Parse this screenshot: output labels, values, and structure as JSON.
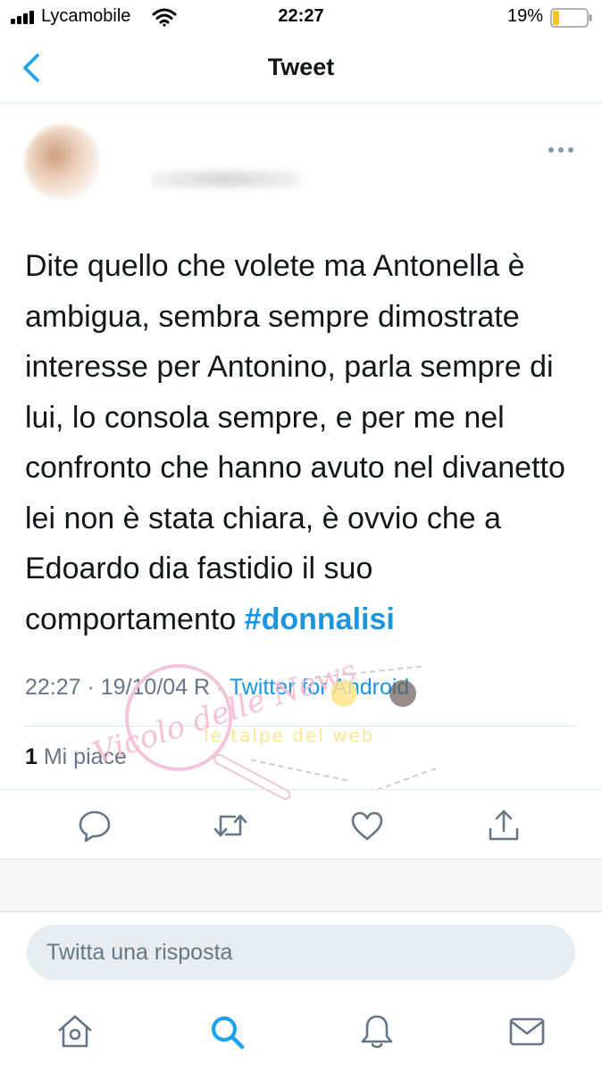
{
  "status_bar": {
    "carrier": "Lycamobile",
    "time": "22:27",
    "battery_percent": "19%",
    "battery_level": 0.19,
    "battery_color": "#f5c518"
  },
  "nav": {
    "title": "Tweet",
    "back_icon": "chevron-left-icon"
  },
  "tweet": {
    "text": "Dite quello che volete ma Antonella è ambigua, sembra sempre dimostrate interesse per Antonino, parla sempre di lui, lo consola sempre, e per me nel confronto che hanno avuto nel divanetto lei non è stata chiara, è ovvio che a Edoardo dia fastidio il suo comportamento ",
    "hashtag": "#donnalisi",
    "timestamp": "22:27 · 19/10/04 R · ",
    "source": "Twitter for Android",
    "likes_count": "1",
    "likes_label": " Mi piace"
  },
  "actions": [
    "reply-icon",
    "retweet-icon",
    "like-icon",
    "share-icon"
  ],
  "watermark": {
    "script_text": "Vicolo delle News",
    "banner_text": "le talpe del web"
  },
  "reply": {
    "placeholder": "Twitta una risposta"
  },
  "tabbar": [
    "home-icon",
    "search-icon",
    "notifications-icon",
    "messages-icon"
  ],
  "colors": {
    "accent": "#1da1f2",
    "hashtag": "#1b95e0",
    "secondary_text": "#657786",
    "icon": "#657786"
  }
}
